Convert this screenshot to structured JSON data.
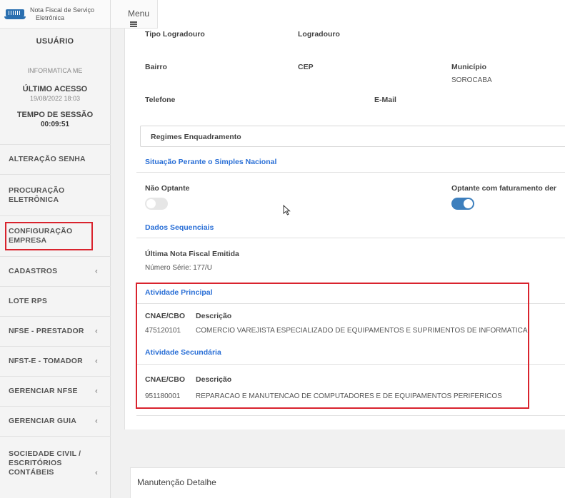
{
  "app": {
    "logo_text_line1": "Nota Fiscal de Serviço",
    "logo_text_line2": "Eletrônica",
    "menu_label": "Menu"
  },
  "user": {
    "title": "USUÁRIO",
    "name": "INFORMATICA ME",
    "ultimo_acesso_label": "ÚLTIMO ACESSO",
    "ultimo_acesso_value": "19/08/2022 18:03",
    "tempo_sessao_label": "TEMPO DE SESSÃO",
    "tempo_sessao_value": "00:09:51"
  },
  "sidebar": {
    "items": [
      {
        "line1": "ALTERAÇÃO SENHA",
        "line2": "",
        "chevron": ""
      },
      {
        "line1": "PROCURAÇÃO",
        "line2": "ELETRÔNICA",
        "chevron": ""
      },
      {
        "line1": "CONFIGURAÇÃO",
        "line2": "EMPRESA",
        "chevron": ""
      },
      {
        "line1": "CADASTROS",
        "line2": "",
        "chevron": "‹"
      },
      {
        "line1": "LOTE RPS",
        "line2": "",
        "chevron": ""
      },
      {
        "line1": "NFSE - PRESTADOR",
        "line2": "",
        "chevron": "‹"
      },
      {
        "line1": "NFST-E - TOMADOR",
        "line2": "",
        "chevron": "‹"
      },
      {
        "line1": "GERENCIAR NFSE",
        "line2": "",
        "chevron": "‹"
      },
      {
        "line1": "GERENCIAR GUIA",
        "line2": "",
        "chevron": "‹"
      },
      {
        "line1": "SOCIEDADE CIVIL /",
        "line2": "ESCRITÓRIOS",
        "line3": "CONTÁBEIS",
        "chevron": "‹"
      }
    ]
  },
  "form": {
    "tipo_logradouro_label": "Tipo Logradouro",
    "logradouro_label": "Logradouro",
    "bairro_label": "Bairro",
    "cep_label": "CEP",
    "municipio_label": "Município",
    "municipio_value": "SOROCABA",
    "telefone_label": "Telefone",
    "email_label": "E-Mail",
    "regimes_label": "Regimes Enquadramento",
    "situacao_label": "Situação Perante o Simples Nacional",
    "nao_optante_label": "Não Optante",
    "optante_label": "Optante com faturamento der",
    "dados_sequenciais_label": "Dados Sequenciais",
    "ultima_nota_label": "Última Nota Fiscal Emitida",
    "numero_serie": "Número Série: 177/U"
  },
  "toggles": {
    "nao_optante": false,
    "optante": true
  },
  "atividade_principal": {
    "title": "Atividade Principal",
    "col_code": "CNAE/CBO",
    "col_desc": "Descrição",
    "code": "475120101",
    "desc": "COMERCIO VAREJISTA ESPECIALIZADO DE EQUIPAMENTOS E SUPRIMENTOS DE INFORMATICA"
  },
  "atividade_secundaria": {
    "title": "Atividade Secundária",
    "col_code": "CNAE/CBO",
    "col_desc": "Descrição",
    "code": "951180001",
    "desc": "REPARACAO E MANUTENCAO DE COMPUTADORES E DE EQUIPAMENTOS PERIFERICOS"
  },
  "bottom": {
    "title": "Manutenção Detalhe"
  },
  "colors": {
    "accent_blue": "#2a6fd6",
    "highlight_red": "#d9232d",
    "toggle_on": "#3d7fbd"
  }
}
